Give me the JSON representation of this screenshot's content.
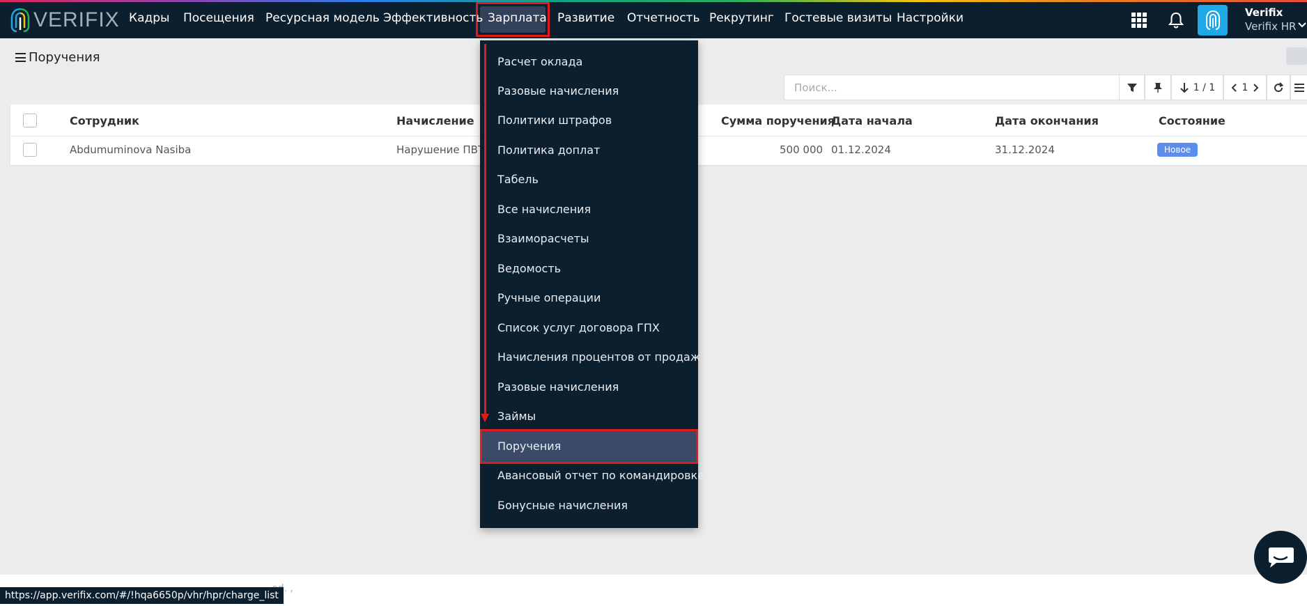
{
  "brand": {
    "name": "VERIFIX"
  },
  "nav": {
    "items": [
      "Кадры",
      "Посещения",
      "Ресурсная модель",
      "Эффективность",
      "Зарплата",
      "Развитие",
      "Отчетность",
      "Рекрутинг",
      "Гостевые визиты",
      "Настройки"
    ],
    "active": "Зарплата"
  },
  "user": {
    "name": "Verifix",
    "company": "Verifix HR"
  },
  "page": {
    "title": "Поручения"
  },
  "toolbar": {
    "search_placeholder": "Поиск...",
    "records": "1 / 1",
    "page": "1"
  },
  "table": {
    "columns": [
      "Сотрудник",
      "Начисление",
      "Сумма поручения",
      "Дата начала",
      "Дата окончания",
      "Состояние"
    ],
    "rows": [
      {
        "employee": "Abdumuminova Nasiba",
        "charge": "Нарушение ПВТР",
        "amount": "500 000",
        "start": "01.12.2024",
        "end": "31.12.2024",
        "status": "Новое"
      }
    ]
  },
  "dropdown": {
    "items": [
      "Расчет оклада",
      "Разовые начисления",
      "Политики штрафов",
      "Политика доплат",
      "Табель",
      "Все начисления",
      "Взаиморасчеты",
      "Ведомость",
      "Ручные операции",
      "Список услуг договора ГПХ",
      "Начисления процентов от продаж",
      "Разовые начисления",
      "Займы",
      "Поручения",
      "Авансовый отчет по командировке",
      "Бонусные начисления"
    ],
    "active": "Поручения"
  },
  "footer": {
    "text": "ed. ,"
  },
  "status_bar": {
    "url": "https://app.verifix.com/#/!hqa6650p/vhr/hpr/charge_list"
  },
  "colors": {
    "navbar": "#0c1f2e",
    "accent": "#1fa8e8",
    "badge": "#5b8def",
    "highlight": "#e01b1b"
  },
  "icons": [
    "logo-icon",
    "apps-grid-icon",
    "bell-icon",
    "avatar-fingerprint-icon",
    "chevron-down-icon",
    "hamburger-icon",
    "filter-icon",
    "pin-icon",
    "sort-down-icon",
    "chevron-left-icon",
    "chevron-right-icon",
    "refresh-icon",
    "list-icon",
    "chat-icon"
  ]
}
